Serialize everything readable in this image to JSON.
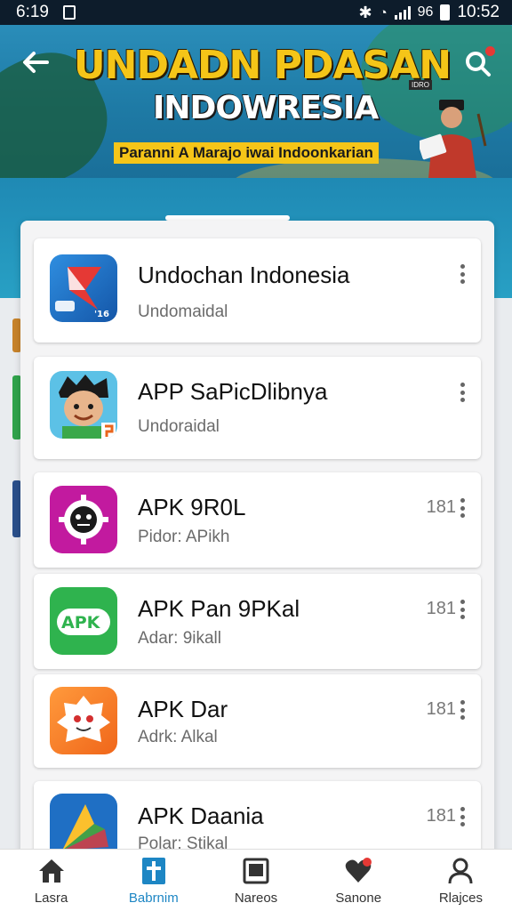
{
  "status_bar": {
    "time": "6:19",
    "battery_text": "96",
    "clock_right": "10:52"
  },
  "header": {
    "back_icon": "arrow-left-icon",
    "search_icon": "search-icon",
    "title": "UNDADN PDASAN",
    "subtitle": "INDOWRESIA",
    "tagline": "Paranni A Marajo iwai Indoonkarian",
    "badge": "IDRO"
  },
  "apps": [
    {
      "title": "Undochan Indonesia",
      "subtitle": "Undomaidal",
      "meta": "",
      "icon": "star-logo-icon"
    },
    {
      "title": "APP SaPicDlibnya",
      "subtitle": "Undoraidal",
      "meta": "",
      "icon": "cartoon-character-icon"
    },
    {
      "title": "APK 9R0L",
      "subtitle": "Pidor: APikh",
      "meta": "181",
      "icon": "gear-face-icon"
    },
    {
      "title": "APK Pan 9PKal",
      "subtitle": "Adar: 9ikall",
      "meta": "181",
      "icon": "apk-logo-icon"
    },
    {
      "title": "APK Dar",
      "subtitle": "Adrk: Alkal",
      "meta": "181",
      "icon": "ghost-face-icon"
    },
    {
      "title": "APK Daania",
      "subtitle": "Polar: Stikal",
      "meta": "181",
      "icon": "play-arrow-icon"
    }
  ],
  "bottom_nav": [
    {
      "label": "Lasra",
      "icon": "home-icon",
      "active": false
    },
    {
      "label": "Babrnim",
      "icon": "bookmark-cross-icon",
      "active": true
    },
    {
      "label": "Nareos",
      "icon": "image-icon",
      "active": false
    },
    {
      "label": "Sanone",
      "icon": "heart-badge-icon",
      "active": false
    },
    {
      "label": "Rlajces",
      "icon": "profile-icon",
      "active": false
    }
  ],
  "colors": {
    "accent": "#1d86c4",
    "banner": "#1e7aa5",
    "title_yellow": "#f5c518"
  }
}
